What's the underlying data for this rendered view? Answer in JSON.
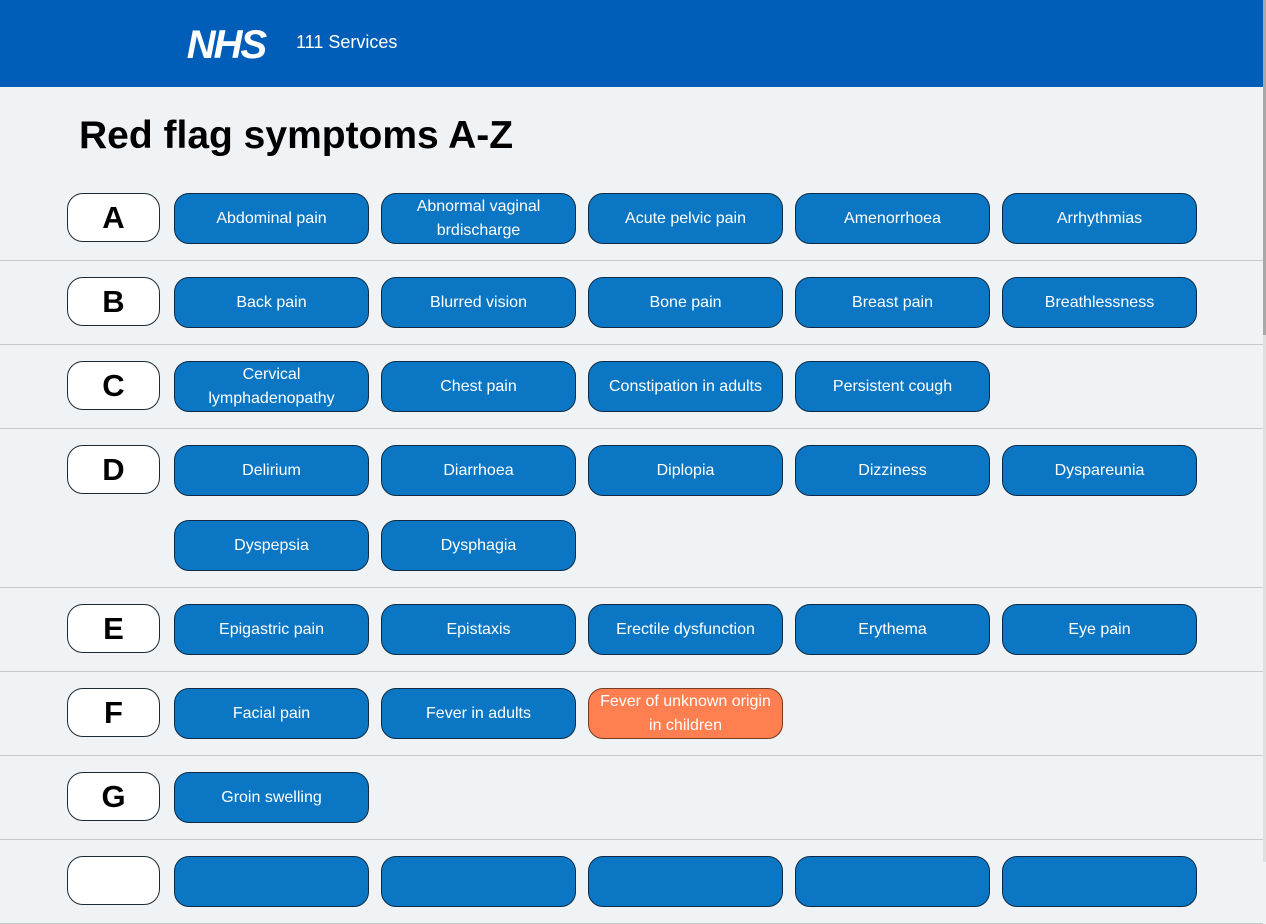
{
  "header": {
    "logo_text": "NHS",
    "service_name": "111 Services",
    "brand_color": "#005eb8"
  },
  "page": {
    "title": "Red flag symptoms A-Z"
  },
  "colors": {
    "button": "#0b77c4",
    "button_highlight": "#ff7f50",
    "background": "#eff3f5"
  },
  "groups": [
    {
      "letter": "A",
      "items": [
        {
          "label": "Abdominal pain"
        },
        {
          "label": "Abnormal vaginal brdischarge"
        },
        {
          "label": "Acute pelvic pain"
        },
        {
          "label": "Amenorrhoea"
        },
        {
          "label": "Arrhythmias"
        }
      ]
    },
    {
      "letter": "B",
      "items": [
        {
          "label": "Back pain"
        },
        {
          "label": "Blurred vision"
        },
        {
          "label": "Bone pain"
        },
        {
          "label": "Breast pain"
        },
        {
          "label": "Breathlessness"
        }
      ]
    },
    {
      "letter": "C",
      "items": [
        {
          "label": "Cervical lymphadenopathy"
        },
        {
          "label": "Chest pain"
        },
        {
          "label": "Constipation in adults"
        },
        {
          "label": "Persistent cough"
        }
      ]
    },
    {
      "letter": "D",
      "items": [
        {
          "label": "Delirium"
        },
        {
          "label": "Diarrhoea"
        },
        {
          "label": "Diplopia"
        },
        {
          "label": "Dizziness"
        },
        {
          "label": "Dyspareunia"
        },
        {
          "label": "Dyspepsia"
        },
        {
          "label": "Dysphagia"
        }
      ]
    },
    {
      "letter": "E",
      "items": [
        {
          "label": "Epigastric pain"
        },
        {
          "label": "Epistaxis"
        },
        {
          "label": "Erectile dysfunction"
        },
        {
          "label": "Erythema"
        },
        {
          "label": "Eye pain"
        }
      ]
    },
    {
      "letter": "F",
      "items": [
        {
          "label": "Facial pain"
        },
        {
          "label": "Fever in adults"
        },
        {
          "label": "Fever of unknown origin in children",
          "highlight": true
        }
      ]
    },
    {
      "letter": "G",
      "items": [
        {
          "label": "Groin swelling"
        }
      ]
    },
    {
      "letter": "",
      "items": [
        {
          "label": ""
        },
        {
          "label": ""
        },
        {
          "label": ""
        },
        {
          "label": ""
        },
        {
          "label": ""
        }
      ]
    }
  ]
}
